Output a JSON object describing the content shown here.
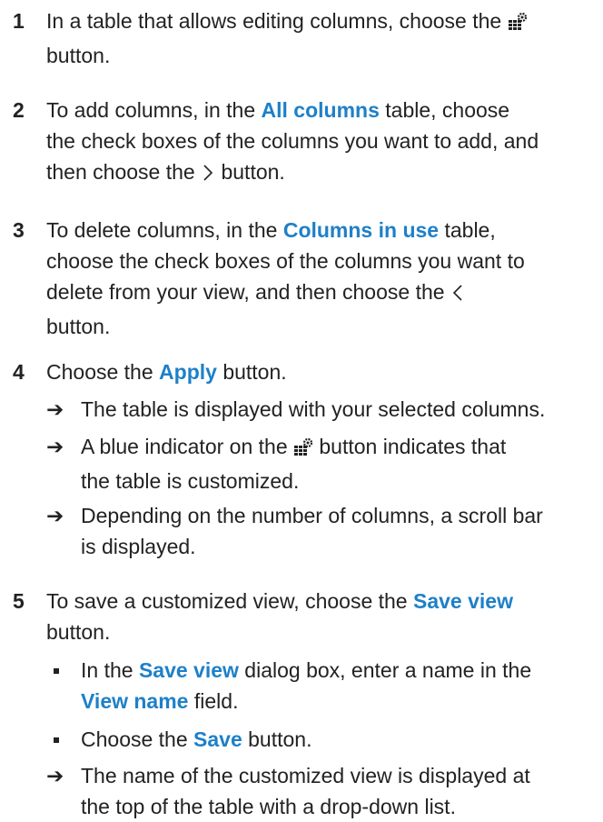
{
  "steps": [
    {
      "num": "1",
      "a": "In a table that allows editing columns, choose the",
      "b": "button."
    },
    {
      "num": "2",
      "a": "To add columns, in the",
      "hl": "All columns",
      "b": "table, choose",
      "c": "the check boxes of the columns you want to add, and",
      "d": "then choose the",
      "e": "button."
    },
    {
      "num": "3",
      "a": "To delete columns, in the",
      "hl": "Columns in use",
      "b": "table,",
      "c": "choose the check boxes of the columns you want to",
      "d": "delete from your view, and then choose the",
      "e": "button."
    },
    {
      "num": "4",
      "a": "Choose the",
      "hl": "Apply",
      "b": "button.",
      "results": [
        {
          "line1": "The table is displayed with your selected columns."
        },
        {
          "a": "A blue indicator on the",
          "b": "button indicates that",
          "c": "the table is customized."
        },
        {
          "a": "Depending on the number of columns, a scroll bar",
          "b": "is displayed."
        }
      ]
    },
    {
      "num": "5",
      "a": "To save a customized view, choose the",
      "hl": "Save view",
      "b": "button.",
      "bullets": [
        {
          "a": "In the",
          "hl": "Save view",
          "b": "dialog box, enter a name in the",
          "hl2": "View name",
          "c": "field."
        },
        {
          "a": "Choose the",
          "hl": "Save",
          "b": "button."
        }
      ],
      "result": {
        "a": "The name of the customized view is displayed at",
        "b": "the top of the table with a drop-down list."
      }
    }
  ],
  "arrow_glyph": "➔",
  "icons": [
    "column-settings-icon",
    "chevron-right-icon",
    "chevron-left-icon",
    "bullet-icon"
  ],
  "colors": {
    "highlight": "#1e80c8",
    "text": "#222222"
  }
}
